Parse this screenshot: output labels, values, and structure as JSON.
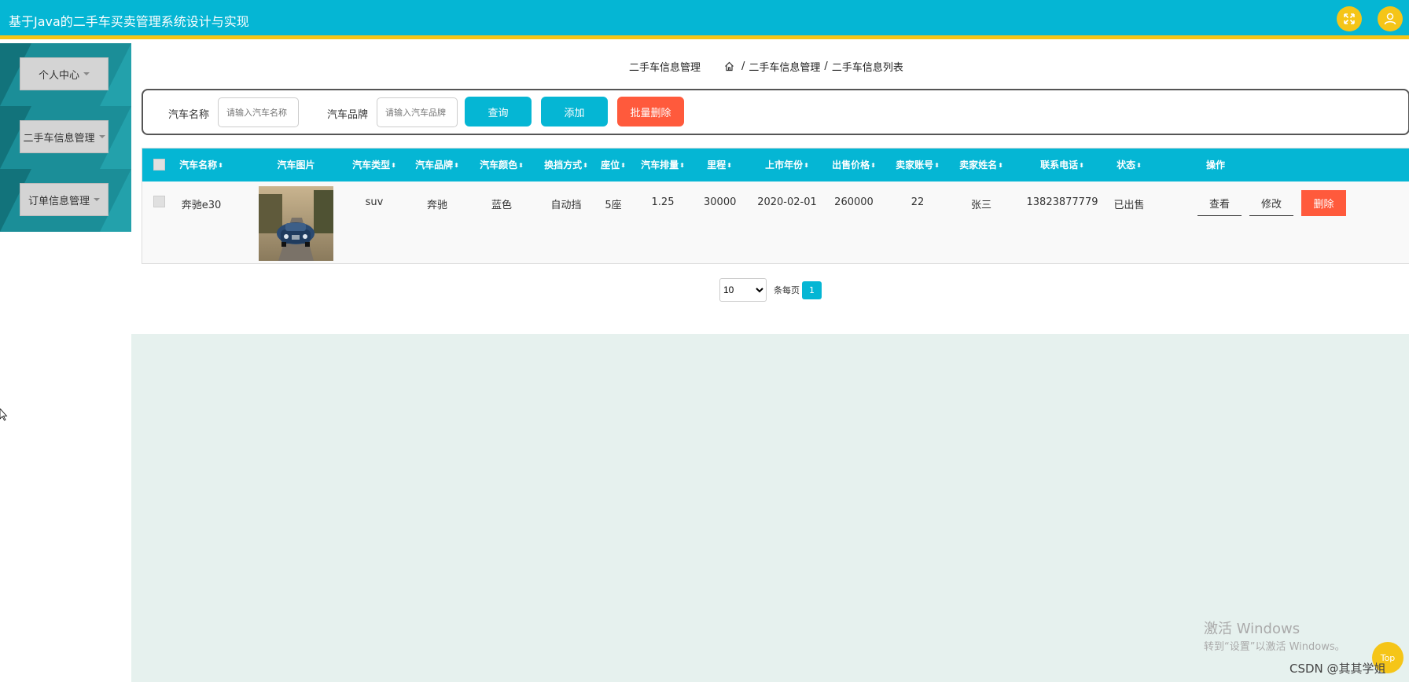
{
  "header": {
    "title": "基于Java的二手车买卖管理系统设计与实现",
    "fullscreen_icon": "expand-icon",
    "user_icon": "user-icon"
  },
  "sidebar": {
    "items": [
      {
        "label": "个人中心"
      },
      {
        "label": "二手车信息管理"
      },
      {
        "label": "订单信息管理"
      }
    ]
  },
  "breadcrumb": {
    "page_title": "二手车信息管理",
    "home_icon": "home-icon",
    "crumbs": [
      "二手车信息管理",
      "二手车信息列表"
    ],
    "separator": "/"
  },
  "search": {
    "name_label": "汽车名称",
    "name_placeholder": "请输入汽车名称",
    "brand_label": "汽车品牌",
    "brand_placeholder": "请输入汽车品牌",
    "query_label": "查询",
    "add_label": "添加",
    "batch_delete_label": "批量删除"
  },
  "table": {
    "headers": [
      "汽车名称",
      "汽车图片",
      "汽车类型",
      "汽车品牌",
      "汽车颜色",
      "换挡方式",
      "座位",
      "汽车排量",
      "里程",
      "上市年份",
      "出售价格",
      "卖家账号",
      "卖家姓名",
      "联系电话",
      "状态",
      "操作"
    ],
    "sort_icon": "sort-icon",
    "rows": [
      {
        "name": "奔驰e30",
        "type": "suv",
        "brand": "奔驰",
        "color": "蓝色",
        "transmission": "自动挡",
        "seats": "5座",
        "displacement": "1.25",
        "mileage": "30000",
        "year": "2020-02-01",
        "price": "260000",
        "seller_account": "22",
        "seller_name": "张三",
        "phone": "13823877779",
        "status": "已出售",
        "view_label": "查看",
        "edit_label": "修改",
        "delete_label": "删除"
      }
    ]
  },
  "pagination": {
    "page_size": "10",
    "page_size_options": [
      "10"
    ],
    "per_page_label": "条每页",
    "current_page": "1"
  },
  "watermark": {
    "line1": "激活 Windows",
    "line2": "转到“设置”以激活 Windows。"
  },
  "top_badge": "Top",
  "csdn": "CSDN @其其学姐",
  "colors": {
    "primary": "#05b6d4",
    "accent": "#f5c518",
    "danger": "#ff5a3c",
    "sidebar": "#1b8e98"
  }
}
